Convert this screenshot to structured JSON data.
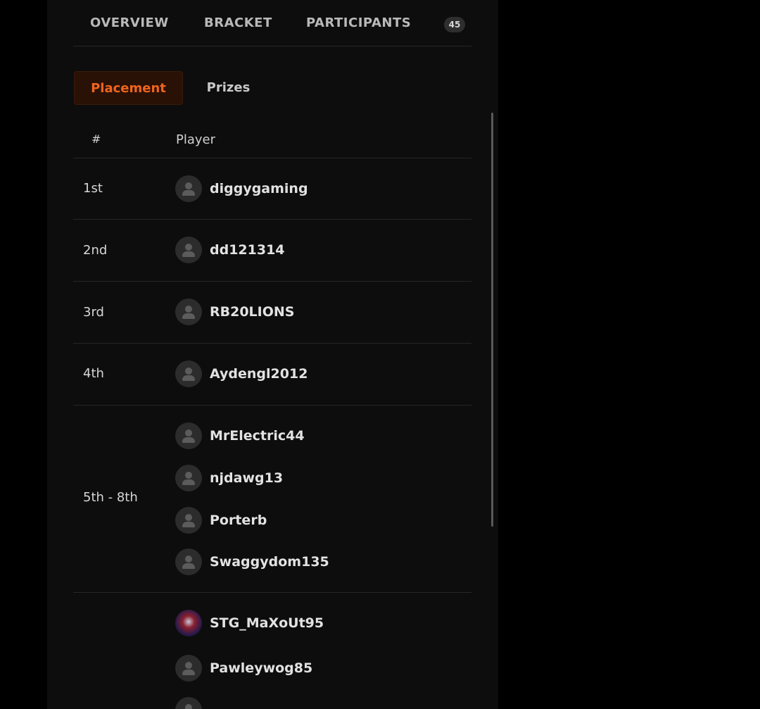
{
  "nav": {
    "tabs": [
      {
        "label": "OVERVIEW"
      },
      {
        "label": "BRACKET"
      },
      {
        "label": "PARTICIPANTS"
      }
    ],
    "participants_count": "45"
  },
  "subtabs": {
    "placement": "Placement",
    "prizes": "Prizes"
  },
  "table": {
    "col_rank": "#",
    "col_player": "Player",
    "rows": [
      {
        "rank": "1st",
        "players": [
          "diggygaming"
        ]
      },
      {
        "rank": "2nd",
        "players": [
          "dd121314"
        ]
      },
      {
        "rank": "3rd",
        "players": [
          "RB20LIONS"
        ]
      },
      {
        "rank": "4th",
        "players": [
          "Aydengl2012"
        ]
      },
      {
        "rank": "5th - 8th",
        "players": [
          "MrElectric44",
          "njdawg13",
          "Porterb",
          "Swaggydom135"
        ]
      },
      {
        "rank": "",
        "players": [
          "STG_MaXoUt95",
          "Pawleywog85"
        ]
      }
    ]
  },
  "colors": {
    "accent": "#f0641e",
    "panel": "#0d0d0d",
    "background": "#000000"
  }
}
